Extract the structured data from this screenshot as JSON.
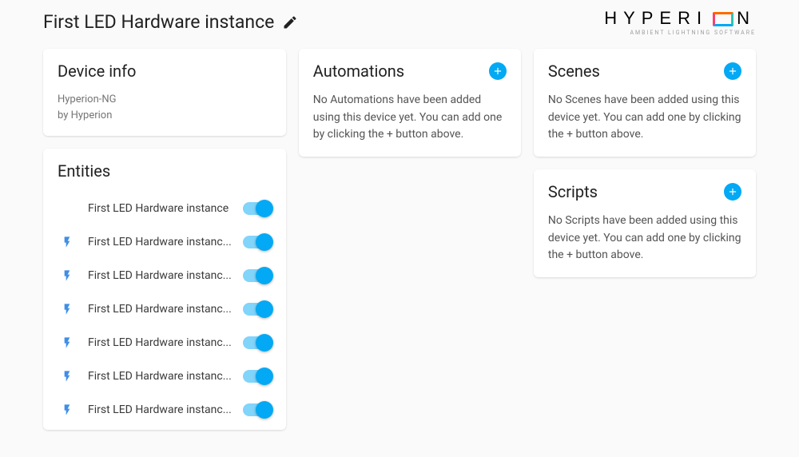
{
  "header": {
    "title": "First LED Hardware instance",
    "logo_text_before": "HYPERI",
    "logo_text_after": "N",
    "logo_sub": "AMBIENT LIGHTNING SOFTWARE"
  },
  "device_info": {
    "title": "Device info",
    "line1": "Hyperion-NG",
    "line2": "by Hyperion"
  },
  "entities": {
    "title": "Entities",
    "items": [
      {
        "icon": false,
        "label": "First LED Hardware instance",
        "on": true
      },
      {
        "icon": true,
        "label": "First LED Hardware instanc...",
        "on": true
      },
      {
        "icon": true,
        "label": "First LED Hardware instanc...",
        "on": true
      },
      {
        "icon": true,
        "label": "First LED Hardware instanc...",
        "on": true
      },
      {
        "icon": true,
        "label": "First LED Hardware instanc...",
        "on": true
      },
      {
        "icon": true,
        "label": "First LED Hardware instanc...",
        "on": true
      },
      {
        "icon": true,
        "label": "First LED Hardware instanc...",
        "on": true
      }
    ]
  },
  "automations": {
    "title": "Automations",
    "body": "No Automations have been added using this device yet. You can add one by clicking the + button above."
  },
  "scenes": {
    "title": "Scenes",
    "body": "No Scenes have been added using this device yet. You can add one by clicking the + button above."
  },
  "scripts": {
    "title": "Scripts",
    "body": "No Scripts have been added using this device yet. You can add one by clicking the + button above."
  }
}
